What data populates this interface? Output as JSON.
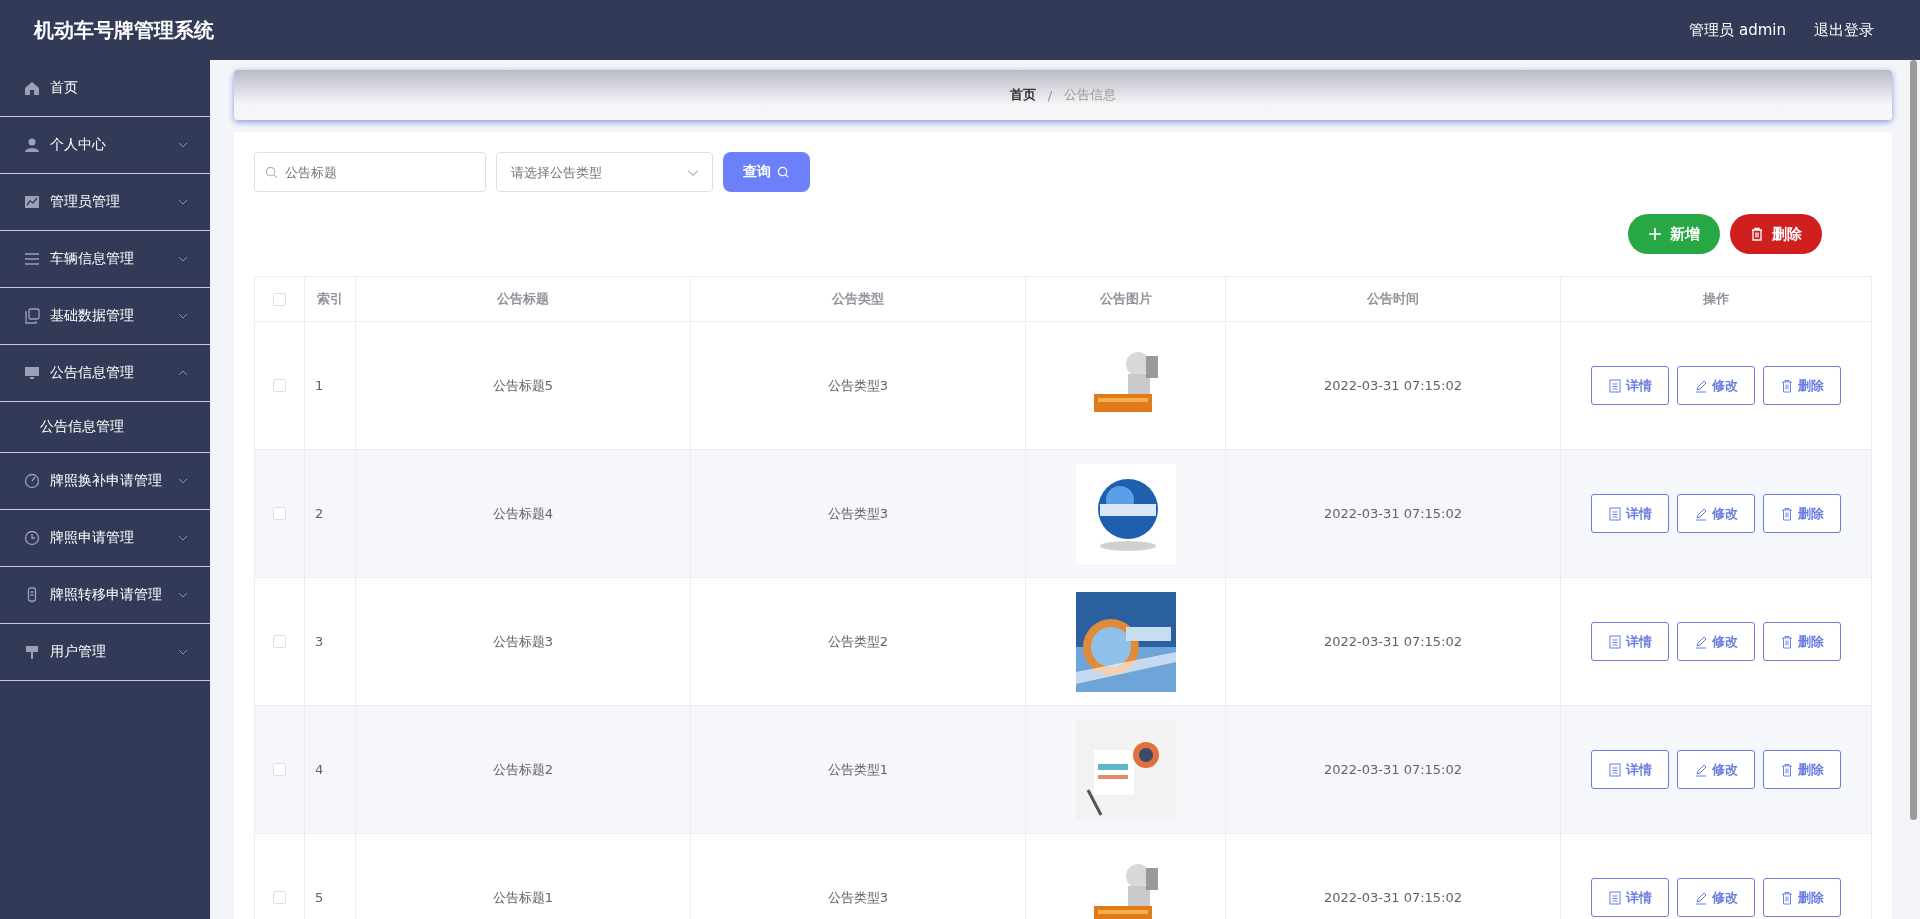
{
  "header": {
    "title": "机动车号牌管理系统",
    "user": "管理员 admin",
    "logout": "退出登录"
  },
  "sidebar": {
    "items": [
      {
        "label": "首页",
        "has_arrow": false
      },
      {
        "label": "个人中心",
        "has_arrow": true,
        "expanded": false
      },
      {
        "label": "管理员管理",
        "has_arrow": true,
        "expanded": false
      },
      {
        "label": "车辆信息管理",
        "has_arrow": true,
        "expanded": false
      },
      {
        "label": "基础数据管理",
        "has_arrow": true,
        "expanded": false
      },
      {
        "label": "公告信息管理",
        "has_arrow": true,
        "expanded": true,
        "children": [
          {
            "label": "公告信息管理"
          }
        ]
      },
      {
        "label": "牌照换补申请管理",
        "has_arrow": true,
        "expanded": false
      },
      {
        "label": "牌照申请管理",
        "has_arrow": true,
        "expanded": false
      },
      {
        "label": "牌照转移申请管理",
        "has_arrow": true,
        "expanded": false
      },
      {
        "label": "用户管理",
        "has_arrow": true,
        "expanded": false
      }
    ]
  },
  "breadcrumb": {
    "separator": "/",
    "items": [
      {
        "label": "首页",
        "current": false
      },
      {
        "label": "公告信息",
        "current": true
      }
    ]
  },
  "search": {
    "title_placeholder": "公告标题",
    "type_placeholder": "请选择公告类型",
    "button": "查询"
  },
  "actions": {
    "add": "新增",
    "delete": "删除"
  },
  "table": {
    "all_checked": false,
    "columns": [
      "索引",
      "公告标题",
      "公告类型",
      "公告图片",
      "公告时间",
      "操作"
    ],
    "rows": [
      {
        "checked": false,
        "index": "1",
        "title": "公告标题5",
        "type": "公告类型3",
        "time": "2022-03-31 07:15:02",
        "buttons": [
          "详情",
          "修改",
          "删除"
        ]
      },
      {
        "checked": false,
        "index": "2",
        "title": "公告标题4",
        "type": "公告类型3",
        "time": "2022-03-31 07:15:02",
        "buttons": [
          "详情",
          "修改",
          "删除"
        ]
      },
      {
        "checked": false,
        "index": "3",
        "title": "公告标题3",
        "type": "公告类型2",
        "time": "2022-03-31 07:15:02",
        "buttons": [
          "详情",
          "修改",
          "删除"
        ]
      },
      {
        "checked": false,
        "index": "4",
        "title": "公告标题2",
        "type": "公告类型1",
        "time": "2022-03-31 07:15:02",
        "buttons": [
          "详情",
          "修改",
          "删除"
        ]
      },
      {
        "checked": false,
        "index": "5",
        "title": "公告标题1",
        "type": "公告类型3",
        "time": "2022-03-31 07:15:02",
        "buttons": [
          "详情",
          "修改",
          "删除"
        ]
      }
    ]
  }
}
